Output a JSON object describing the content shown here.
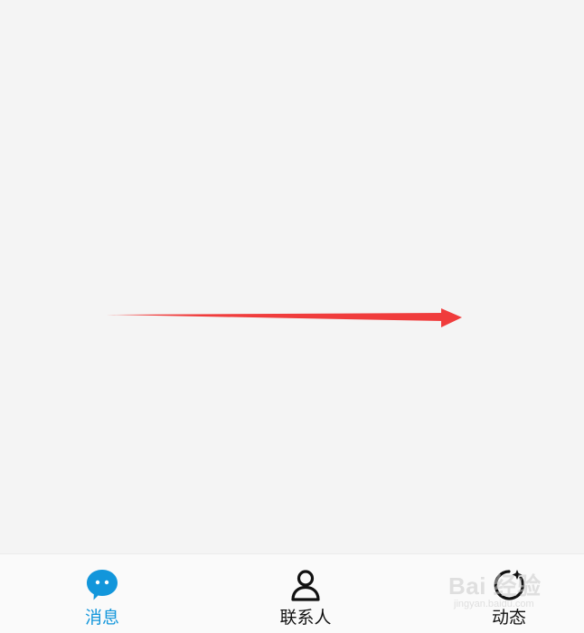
{
  "colors": {
    "background": "#f4f4f4",
    "tabbar_background": "#fafafa",
    "active_tab": "#1296db",
    "inactive_tab": "#111111",
    "annotation_arrow": "#f03c3c"
  },
  "annotation": {
    "type": "arrow",
    "direction": "right"
  },
  "tabbar": {
    "active_tab": "messages",
    "tabs": [
      {
        "id": "messages",
        "label": "消息",
        "icon": "chat-bubble-icon"
      },
      {
        "id": "contacts",
        "label": "联系人",
        "icon": "person-icon"
      },
      {
        "id": "feeds",
        "label": "动态",
        "icon": "star-orbit-icon"
      }
    ]
  },
  "watermark": {
    "text": "Bai 经验",
    "url_text": "jingyan.baidu.com"
  }
}
